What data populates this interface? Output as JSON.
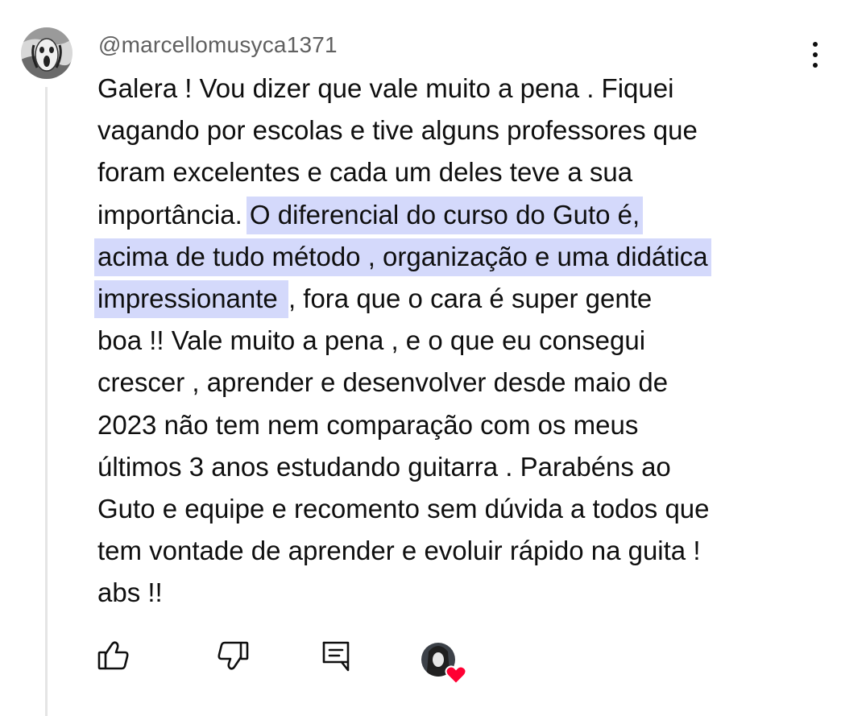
{
  "comment": {
    "author": "@marcellomusyca1371",
    "avatar_icon": "scream-painting-avatar-icon",
    "menu_icon": "more-vertical-icon",
    "highlight_color": "#d4d9fb",
    "lines": [
      {
        "plain": "Galera !  Vou dizer que vale muito a pena . Fiquei"
      },
      {
        "plain": "vagando por escolas e tive alguns professores que"
      },
      {
        "plain": "foram excelentes e cada um deles teve a sua"
      },
      {
        "plain": "importância.",
        "highlight": "O diferencial do curso do Guto é,"
      },
      {
        "highlight": "acima de tudo método , organização e uma didática"
      },
      {
        "highlight": "impressionante ",
        "after": ", fora  que o cara é super gente"
      },
      {
        "plain": "boa !!  Vale muito a pena , e o que eu  consegui"
      },
      {
        "plain": "crescer , aprender e desenvolver desde maio de"
      },
      {
        "plain": "2023 não tem nem comparação com os meus"
      },
      {
        "plain": "últimos 3 anos estudando guitarra . Parabéns ao"
      },
      {
        "plain": "Guto e equipe e recomento sem dúvida a todos que"
      },
      {
        "plain": "tem vontade de aprender e evoluir rápido na guita !"
      },
      {
        "plain": "abs !!"
      }
    ]
  },
  "actions": {
    "like_icon": "thumbs-up-icon",
    "dislike_icon": "thumbs-down-icon",
    "reply_icon": "reply-comment-icon",
    "creator_heart_icon": "creator-heart-icon",
    "heart_color": "#ff0033"
  }
}
